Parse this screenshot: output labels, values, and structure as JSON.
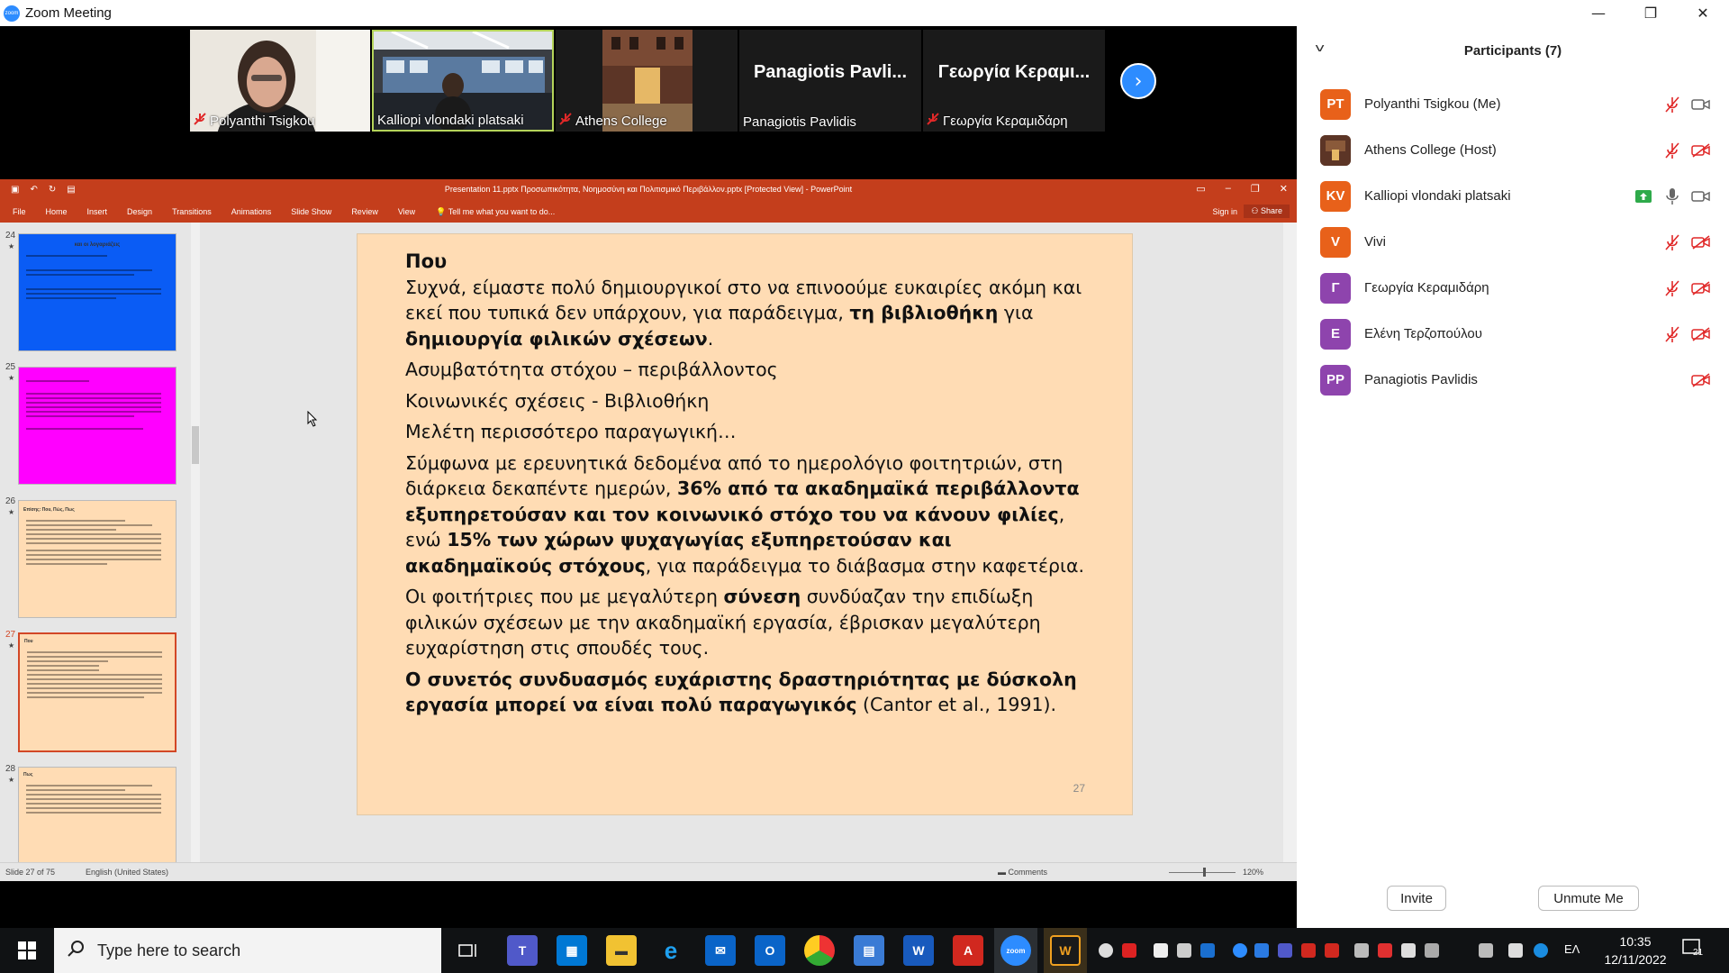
{
  "app": {
    "title": "Zoom Meeting"
  },
  "video_tiles": [
    {
      "name": "Polyanthi Tsigkou",
      "muted": true,
      "has_video": true
    },
    {
      "name": "Kalliopi vlondaki platsaki",
      "muted": false,
      "has_video": true
    },
    {
      "name": "Athens College",
      "muted": true,
      "has_video": true
    },
    {
      "name": "Panagiotis Pavlidis",
      "display": "Panagiotis Pavli...",
      "muted": false,
      "has_video": false
    },
    {
      "name": "Γεωργία Κεραμιδάρη",
      "display": "Γεωργία Κεραμι...",
      "muted": true,
      "has_video": false
    }
  ],
  "participants": {
    "title": "Participants (7)",
    "list": [
      {
        "initials": "PT",
        "name": "Polyanthi Tsigkou (Me)",
        "color": "#e8611a",
        "audio": "muted",
        "video": "on"
      },
      {
        "initials": "",
        "name": "Athens College (Host)",
        "color": "#7a4a2a",
        "audio": "muted",
        "video": "off"
      },
      {
        "initials": "KV",
        "name": "Kalliopi vlondaki platsaki",
        "color": "#e8611a",
        "audio": "on",
        "video": "on"
      },
      {
        "initials": "V",
        "name": "Vivi",
        "color": "#e8611a",
        "audio": "muted",
        "video": "off"
      },
      {
        "initials": "Γ",
        "name": "Γεωργία Κεραμιδάρη",
        "color": "#8e44ad",
        "audio": "muted",
        "video": "off"
      },
      {
        "initials": "Ε",
        "name": "Ελένη Τερζοπούλου",
        "color": "#8e44ad",
        "audio": "muted",
        "video": "off"
      },
      {
        "initials": "PP",
        "name": "Panagiotis Pavlidis",
        "color": "#8e44ad",
        "audio": "none",
        "video": "off"
      }
    ],
    "invite_label": "Invite",
    "unmute_label": "Unmute Me"
  },
  "powerpoint": {
    "doc_title": "Presentation 11.pptx Προσωπικότητα, Νοημοσύνη και Πολιτισμικό Περιβάλλον.pptx [Protected View] - PowerPoint",
    "tabs": [
      "File",
      "Home",
      "Insert",
      "Design",
      "Transitions",
      "Animations",
      "Slide Show",
      "Review",
      "View"
    ],
    "tell_me": "Tell me what you want to do...",
    "sign_in": "Sign in",
    "share": "Share",
    "thumbnails": [
      {
        "num": "24",
        "title": "και οι λογαριάζεις",
        "bg": "#0a5cf5"
      },
      {
        "num": "25",
        "title": "",
        "bg": "#ff00ff"
      },
      {
        "num": "26",
        "title": "Επίσης: Που, Πώς, Πως",
        "bg": "#ffdcb4"
      },
      {
        "num": "27",
        "title": "Που",
        "bg": "#ffdcb4"
      },
      {
        "num": "28",
        "title": "Πως",
        "bg": "#ffdcb4"
      }
    ],
    "slide": {
      "heading": "Που",
      "p1_a": "Συχνά, είμαστε πολύ δημιουργικοί στο να επινοούμε ευκαιρίες ακόμη και εκεί που τυπικά δεν υπάρχουν, για παράδειγμα, ",
      "p1_b": "τη βιβλιοθήκη",
      "p1_c": " για ",
      "p1_d": "δημιουργία φιλικών σχέσεων",
      "p1_e": ".",
      "p2": "Ασυμβατότητα στόχου – περιβάλλοντος",
      "p3": "Κοινωνικές σχέσεις - Βιβλιοθήκη",
      "p4": "Μελέτη περισσότερο παραγωγική…",
      "p5_a": "Σύμφωνα με ερευνητικά δεδομένα από το ημερολόγιο φοιτητριών, στη διάρκεια δεκαπέντε ημερών, ",
      "p5_b": "36% από τα ακαδημαϊκά περιβάλλοντα εξυπηρετούσαν και τον κοινωνικό στόχο του να κάνουν φιλίες",
      "p5_c": ", ενώ ",
      "p5_d": "15% των χώρων ψυχαγωγίας εξυπηρετούσαν και ακαδημαϊκούς στόχους",
      "p5_e": ", για παράδειγμα το διάβασμα στην καφετέρια.",
      "p6_a": "Οι φοιτήτριες που με μεγαλύτερη ",
      "p6_b": "σύνεση",
      "p6_c": " συνδύαζαν την επιδίωξη φιλικών σχέσεων με την ακαδημαϊκή εργασία, έβρισκαν μεγαλύτερη ευχαρίστηση στις σπουδές τους.",
      "p7_a": "Ο συνετός συνδυασμός ευχάριστης δραστηριότητας με δύσκολη εργασία μπορεί να είναι πολύ παραγωγικός",
      "p7_b": " (Cantor et al., 1991).",
      "number": "27"
    },
    "status": {
      "slide_count": "Slide 27 of 75",
      "language": "English (United States)",
      "comments": "Comments",
      "zoom": "120%"
    }
  },
  "taskbar": {
    "search_placeholder": "Type here to search",
    "language": "ΕΛ",
    "time": "10:35",
    "date": "12/11/2022",
    "notifications": "21"
  }
}
